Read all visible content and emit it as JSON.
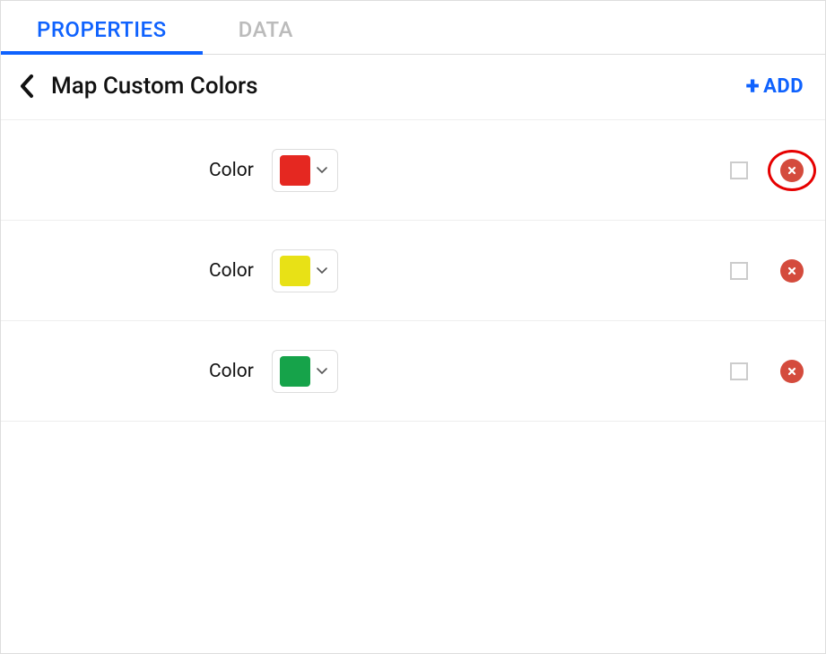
{
  "tabs": {
    "properties": "PROPERTIES",
    "data": "DATA",
    "active": "properties"
  },
  "header": {
    "title": "Map Custom Colors",
    "add_label": "ADD"
  },
  "row_label": "Color",
  "colors": [
    {
      "value": "#e52821",
      "highlighted": true
    },
    {
      "value": "#e8e116",
      "highlighted": false
    },
    {
      "value": "#16a34a",
      "highlighted": false
    }
  ]
}
